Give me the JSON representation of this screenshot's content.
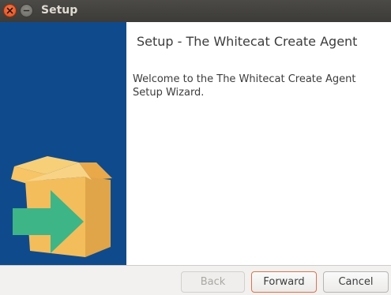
{
  "window": {
    "title": "Setup"
  },
  "titlebar": {
    "close_icon": "close-icon",
    "minimize_icon": "minimize-icon"
  },
  "sidebar": {
    "image": "box-arrow-icon",
    "background_color": "#0f4b8c"
  },
  "content": {
    "heading": "Setup - The Whitecat Create Agent",
    "welcome_text": "Welcome to the The Whitecat Create Agent Setup Wizard."
  },
  "footer": {
    "back_label": "Back",
    "back_enabled": false,
    "forward_label": "Forward",
    "cancel_label": "Cancel"
  },
  "colors": {
    "accent": "#e0714a",
    "sidebar": "#0f4b8c",
    "box": "#f3bd5c",
    "arrow": "#3db587"
  }
}
